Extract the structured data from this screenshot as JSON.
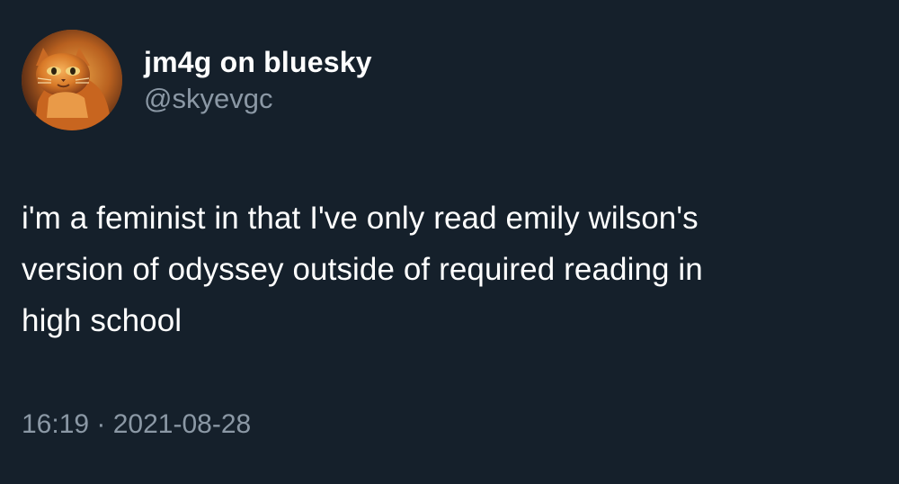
{
  "tweet": {
    "display_name": "jm4g on bluesky",
    "handle": "@skyevgc",
    "text": "i'm a feminist in that I've only read emily wilson's\nversion of odyssey outside of required reading in\nhigh school",
    "timestamp": "16:19 · 2021-08-28"
  },
  "avatar": {
    "description_icon": "cat-avatar-icon"
  },
  "colors": {
    "background": "#15202b",
    "primary_text": "#ffffff",
    "secondary_text": "#8b98a5"
  }
}
